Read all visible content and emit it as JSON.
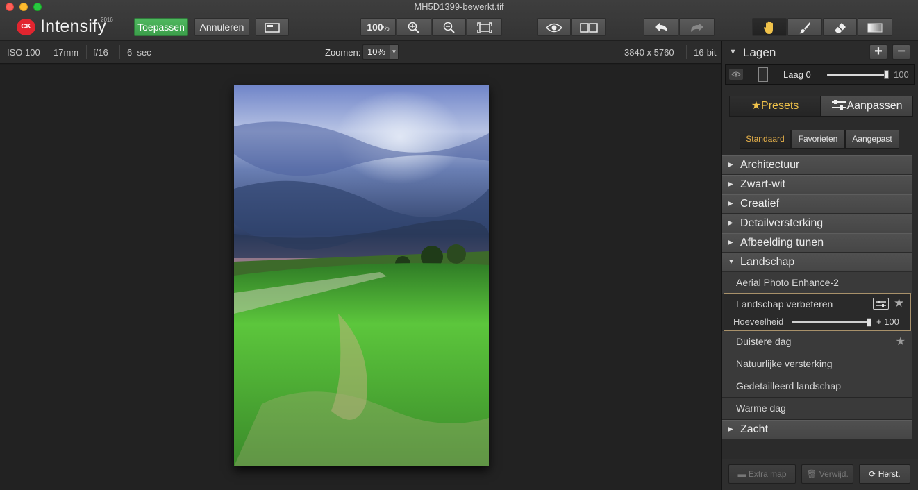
{
  "window": {
    "title": "MH5D1399-bewerkt.tif"
  },
  "logo": {
    "badge": "CK",
    "name": "Intensify",
    "year": "2016"
  },
  "toolbar": {
    "apply_label": "Toepassen",
    "cancel_label": "Annuleren",
    "zoom_level": "100",
    "zoom_unit": "%"
  },
  "info": {
    "iso": "ISO 100",
    "focal": "17mm",
    "aperture": "f/16",
    "exposure": "6  sec",
    "zoom_label": "Zoomen:",
    "zoom_value": "10%",
    "dimensions": "3840 x 5760",
    "bitdepth": "16-bit"
  },
  "layers": {
    "title": "Lagen",
    "add": "+",
    "remove": "−",
    "layer_name": "Laag 0",
    "opacity": "100",
    "opacity_fraction": 1.0
  },
  "tabs": {
    "presets": "Presets",
    "adjust": "Aanpassen"
  },
  "subtabs": {
    "standard": "Standaard",
    "favorites": "Favorieten",
    "custom": "Aangepast"
  },
  "categories": [
    "Architectuur",
    "Zwart-wit",
    "Creatief",
    "Detailversterking",
    "Afbeelding tunen",
    "Landschap",
    "Zacht"
  ],
  "presets": {
    "aerial": "Aerial Photo Enhance-2",
    "active_name": "Landschap verbeteren",
    "amount_label": "Hoeveelheid",
    "amount_value": "+ 100",
    "amount_fraction": 1.0,
    "dark_day": "Duistere dag",
    "natural": "Natuurlijke versterking",
    "detailed": "Gedetailleerd landschap",
    "warm": "Warme dag"
  },
  "footer": {
    "folder": "Extra map",
    "delete": "Verwijd.",
    "reset": "Herst."
  },
  "colors": {
    "accent_green": "#3fa84f",
    "accent_gold": "#f0c24a",
    "active_border": "#a8916a"
  }
}
